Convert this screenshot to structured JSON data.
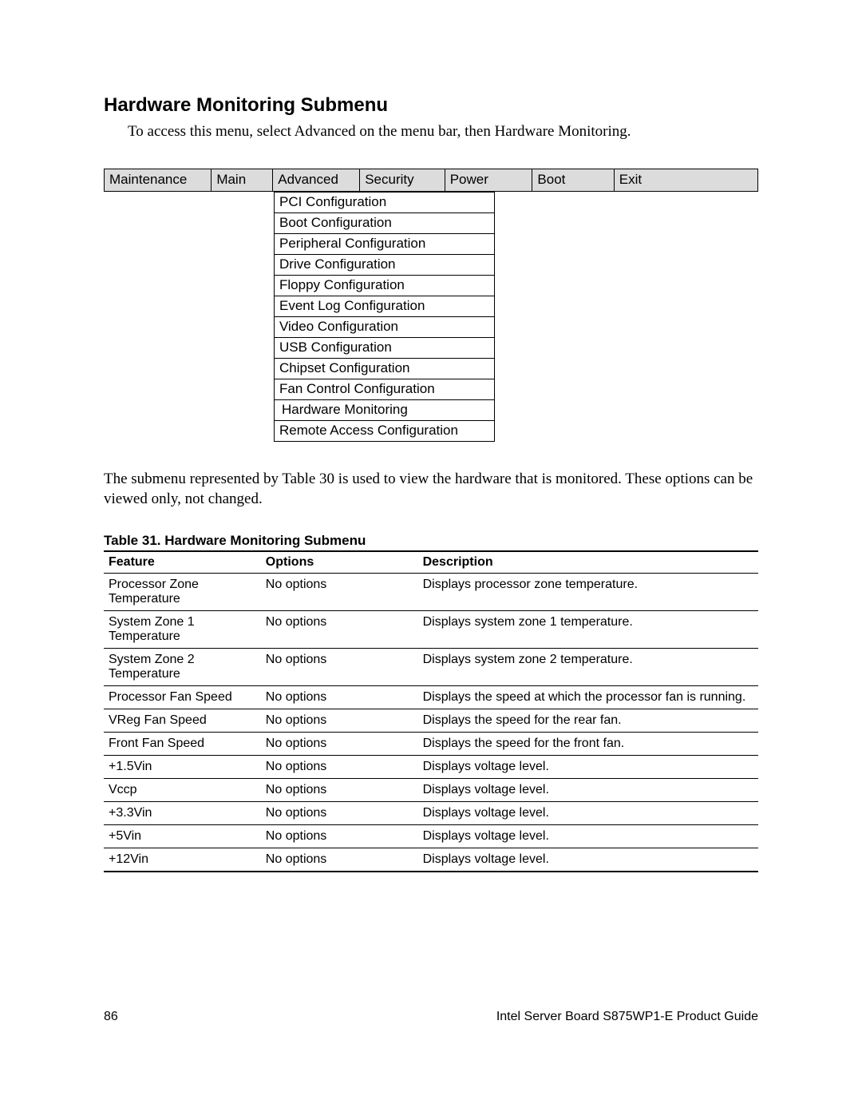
{
  "heading": "Hardware Monitoring Submenu",
  "intro": "To access this menu, select Advanced on the menu bar, then Hardware Monitoring.",
  "menubar": [
    "Maintenance",
    "Main",
    "Advanced",
    "Security",
    "Power",
    "Boot",
    "Exit"
  ],
  "submenu_items": [
    "PCI Configuration",
    "Boot Configuration",
    "Peripheral Configuration",
    "Drive Configuration",
    "Floppy Configuration",
    "Event Log Configuration",
    "Video Configuration",
    "USB Configuration",
    "Chipset Configuration",
    "Fan Control Configuration",
    "Hardware Monitoring",
    "Remote Access Configuration"
  ],
  "midtext": "The submenu represented by Table 30 is used to view the hardware that is monitored.  These options can be viewed only, not changed.",
  "table_caption": "Table 31.    Hardware Monitoring Submenu",
  "table_headers": {
    "feature": "Feature",
    "options": "Options",
    "description": "Description"
  },
  "table_rows": [
    {
      "feature": "Processor Zone Temperature",
      "options": "No options",
      "description": "Displays processor zone temperature."
    },
    {
      "feature": "System Zone 1 Temperature",
      "options": "No options",
      "description": "Displays system zone 1 temperature."
    },
    {
      "feature": "System Zone 2 Temperature",
      "options": "No options",
      "description": "Displays system zone 2 temperature."
    },
    {
      "feature": "Processor Fan Speed",
      "options": "No options",
      "description": "Displays the speed at which the processor fan is running."
    },
    {
      "feature": "VReg Fan Speed",
      "options": "No options",
      "description": "Displays the speed for the rear fan."
    },
    {
      "feature": "Front Fan Speed",
      "options": "No options",
      "description": "Displays the speed for the front fan."
    },
    {
      "feature": "+1.5Vin",
      "options": "No options",
      "description": "Displays voltage level."
    },
    {
      "feature": "Vccp",
      "options": "No options",
      "description": "Displays voltage level."
    },
    {
      "feature": "+3.3Vin",
      "options": "No options",
      "description": "Displays voltage level."
    },
    {
      "feature": "+5Vin",
      "options": "No options",
      "description": "Displays voltage level."
    },
    {
      "feature": "+12Vin",
      "options": "No options",
      "description": "Displays voltage level."
    }
  ],
  "footer": {
    "page_no": "86",
    "guide": "Intel Server Board S875WP1-E Product Guide"
  }
}
